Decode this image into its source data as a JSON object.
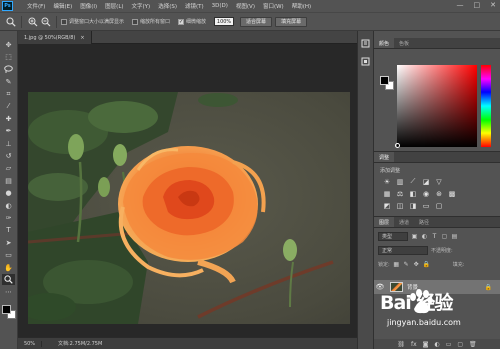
{
  "menu": {
    "logo": "Ps",
    "items": [
      "文件(F)",
      "编辑(E)",
      "图像(I)",
      "图层(L)",
      "文字(Y)",
      "选择(S)",
      "滤镜(T)",
      "3D(D)",
      "视图(V)",
      "窗口(W)",
      "帮助(H)"
    ],
    "controls": [
      "—",
      "□",
      "✕"
    ]
  },
  "options": {
    "resize_windows_label": "调整窗口大小以满屏显示",
    "resize_windows_checked": false,
    "zoom_all_label": "缩放所有窗口",
    "zoom_all_checked": false,
    "scrubby_zoom_label": "细微缩放",
    "scrubby_zoom_checked": true,
    "zoom_value": "100%",
    "fit_screen_label": "适合屏幕",
    "fill_screen_label": "填充屏幕"
  },
  "document": {
    "tab_title": "1.jpg @ 50%(RGB/8)",
    "tab_close": "×",
    "zoom": "50%",
    "file_info": "文档:2.75M/2.75M"
  },
  "panels": {
    "color_tabs": [
      "颜色",
      "色板"
    ],
    "adjust_tabs": [
      "调整"
    ],
    "adjust_subtitle": "添加调整",
    "layers_tabs": [
      "图层",
      "通道",
      "路径"
    ],
    "kind_label": "类型",
    "blend_mode": "正常",
    "opacity_label": "不透明度:",
    "lock_label": "锁定:",
    "fill_label": "填充:",
    "layer_name": "背景"
  },
  "colors": {
    "foreground": "#000000",
    "background": "#ffffff",
    "accent": "#31a8ff"
  },
  "watermark": {
    "brand": "Bai  经验",
    "url": "jingyan.baidu.com"
  }
}
